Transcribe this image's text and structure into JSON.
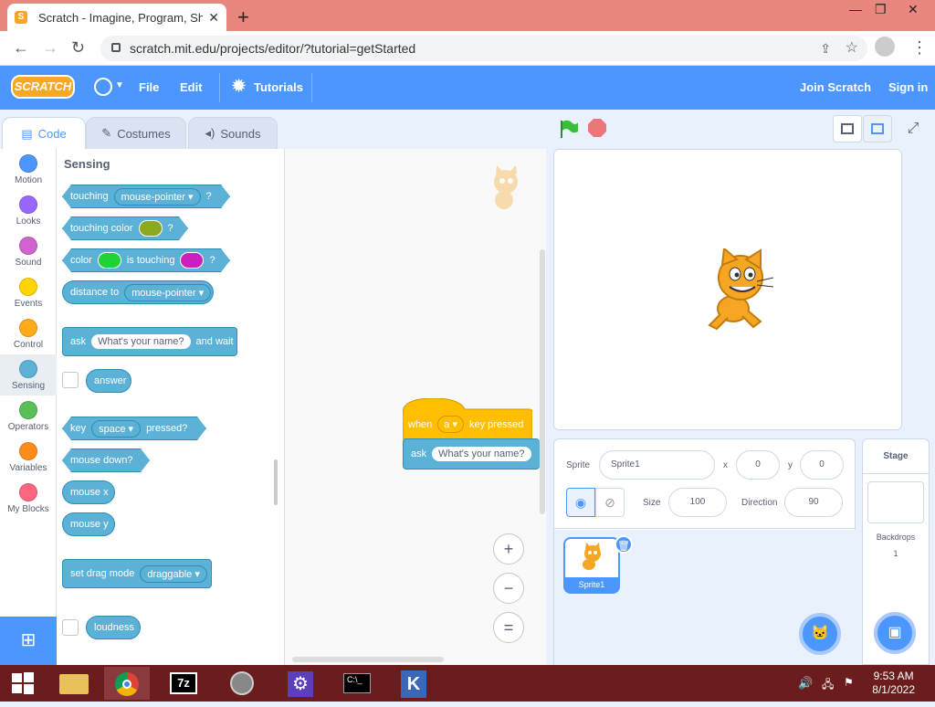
{
  "browser": {
    "tab_title": "Scratch - Imagine, Program, Shar",
    "url": "scratch.mit.edu/projects/editor/?tutorial=getStarted"
  },
  "menu": {
    "logo": "SCRATCH",
    "file": "File",
    "edit": "Edit",
    "tutorials": "Tutorials",
    "join": "Join Scratch",
    "signin": "Sign in"
  },
  "editor_tabs": {
    "code": "Code",
    "costumes": "Costumes",
    "sounds": "Sounds"
  },
  "categories": [
    {
      "label": "Motion",
      "color": "#4c97ff"
    },
    {
      "label": "Looks",
      "color": "#9966ff"
    },
    {
      "label": "Sound",
      "color": "#cf63cf"
    },
    {
      "label": "Events",
      "color": "#ffd500"
    },
    {
      "label": "Control",
      "color": "#ffab19"
    },
    {
      "label": "Sensing",
      "color": "#5cb1d6"
    },
    {
      "label": "Operators",
      "color": "#59c059"
    },
    {
      "label": "Variables",
      "color": "#ff8c1a"
    },
    {
      "label": "My Blocks",
      "color": "#ff6680"
    }
  ],
  "palette": {
    "heading": "Sensing",
    "touching": "touching",
    "mouse_pointer": "mouse-pointer",
    "q": "?",
    "touching_color": "touching color",
    "color": "color",
    "is_touching": "is touching",
    "distance_to": "distance to",
    "ask": "ask",
    "whats_your_name": "What's your name?",
    "and_wait": "and wait",
    "answer": "answer",
    "key": "key",
    "space": "space",
    "pressed": "pressed?",
    "mouse_down": "mouse down?",
    "mouse_x": "mouse x",
    "mouse_y": "mouse y",
    "set_drag_mode": "set drag mode",
    "draggable": "draggable",
    "loudness": "loudness"
  },
  "script": {
    "when": "when",
    "key_value": "a",
    "key_pressed": "key pressed",
    "ask": "ask",
    "question": "What's your name?"
  },
  "zoom": {
    "in": "+",
    "out": "−",
    "reset": "="
  },
  "sprite_info": {
    "sprite_label": "Sprite",
    "sprite_name": "Sprite1",
    "x_label": "x",
    "x": "0",
    "y_label": "y",
    "y": "0",
    "show_label": "Show",
    "size_label": "Size",
    "size": "100",
    "direction_label": "Direction",
    "direction": "90"
  },
  "sprite_list": [
    {
      "name": "Sprite1"
    }
  ],
  "stage_pane": {
    "title": "Stage",
    "backdrops_label": "Backdrops",
    "backdrops_count": "1"
  },
  "taskbar": {
    "time": "9:53 AM",
    "date": "8/1/2022"
  },
  "colors": {
    "scratch_blue": "#4c97ff",
    "sensing": "#5cb1d6",
    "events": "#ffbf00",
    "green_flag": "#3bbf3b",
    "stop": "#ec5959"
  }
}
